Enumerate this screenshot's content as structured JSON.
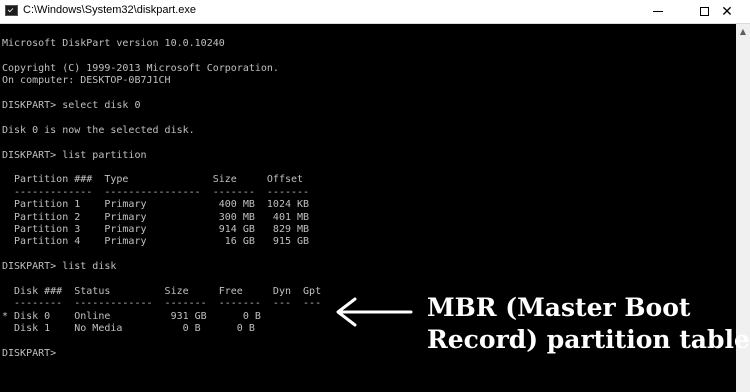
{
  "window": {
    "title": "C:\\Windows\\System32\\diskpart.exe",
    "controls": {
      "minimize": "minimize",
      "maximize": "maximize",
      "close": "✕"
    }
  },
  "console": {
    "lines": [
      "Microsoft DiskPart version 10.0.10240",
      "",
      "Copyright (C) 1999-2013 Microsoft Corporation.",
      "On computer: DESKTOP-0B7J1CH",
      "",
      "DISKPART> select disk 0",
      "",
      "Disk 0 is now the selected disk.",
      "",
      "DISKPART> list partition",
      "",
      "  Partition ###  Type              Size     Offset",
      "  -------------  ----------------  -------  -------",
      "  Partition 1    Primary            400 MB  1024 KB",
      "  Partition 2    Primary            300 MB   401 MB",
      "  Partition 3    Primary            914 GB   829 MB",
      "  Partition 4    Primary             16 GB   915 GB",
      "",
      "DISKPART> list disk",
      "",
      "  Disk ###  Status         Size     Free     Dyn  Gpt",
      "  --------  -------------  -------  -------  ---  ---",
      "* Disk 0    Online          931 GB      0 B",
      "  Disk 1    No Media          0 B      0 B",
      "",
      "DISKPART>"
    ]
  },
  "annotation": {
    "line1": "MBR (Master Boot",
    "line2": "Record) partition table",
    "text_color": "#ffffff"
  },
  "colors": {
    "console_bg": "#000000",
    "console_text": "#c0c0c0",
    "titlebar_bg": "#ffffff"
  },
  "icons": {
    "scroll_up": "▲"
  }
}
